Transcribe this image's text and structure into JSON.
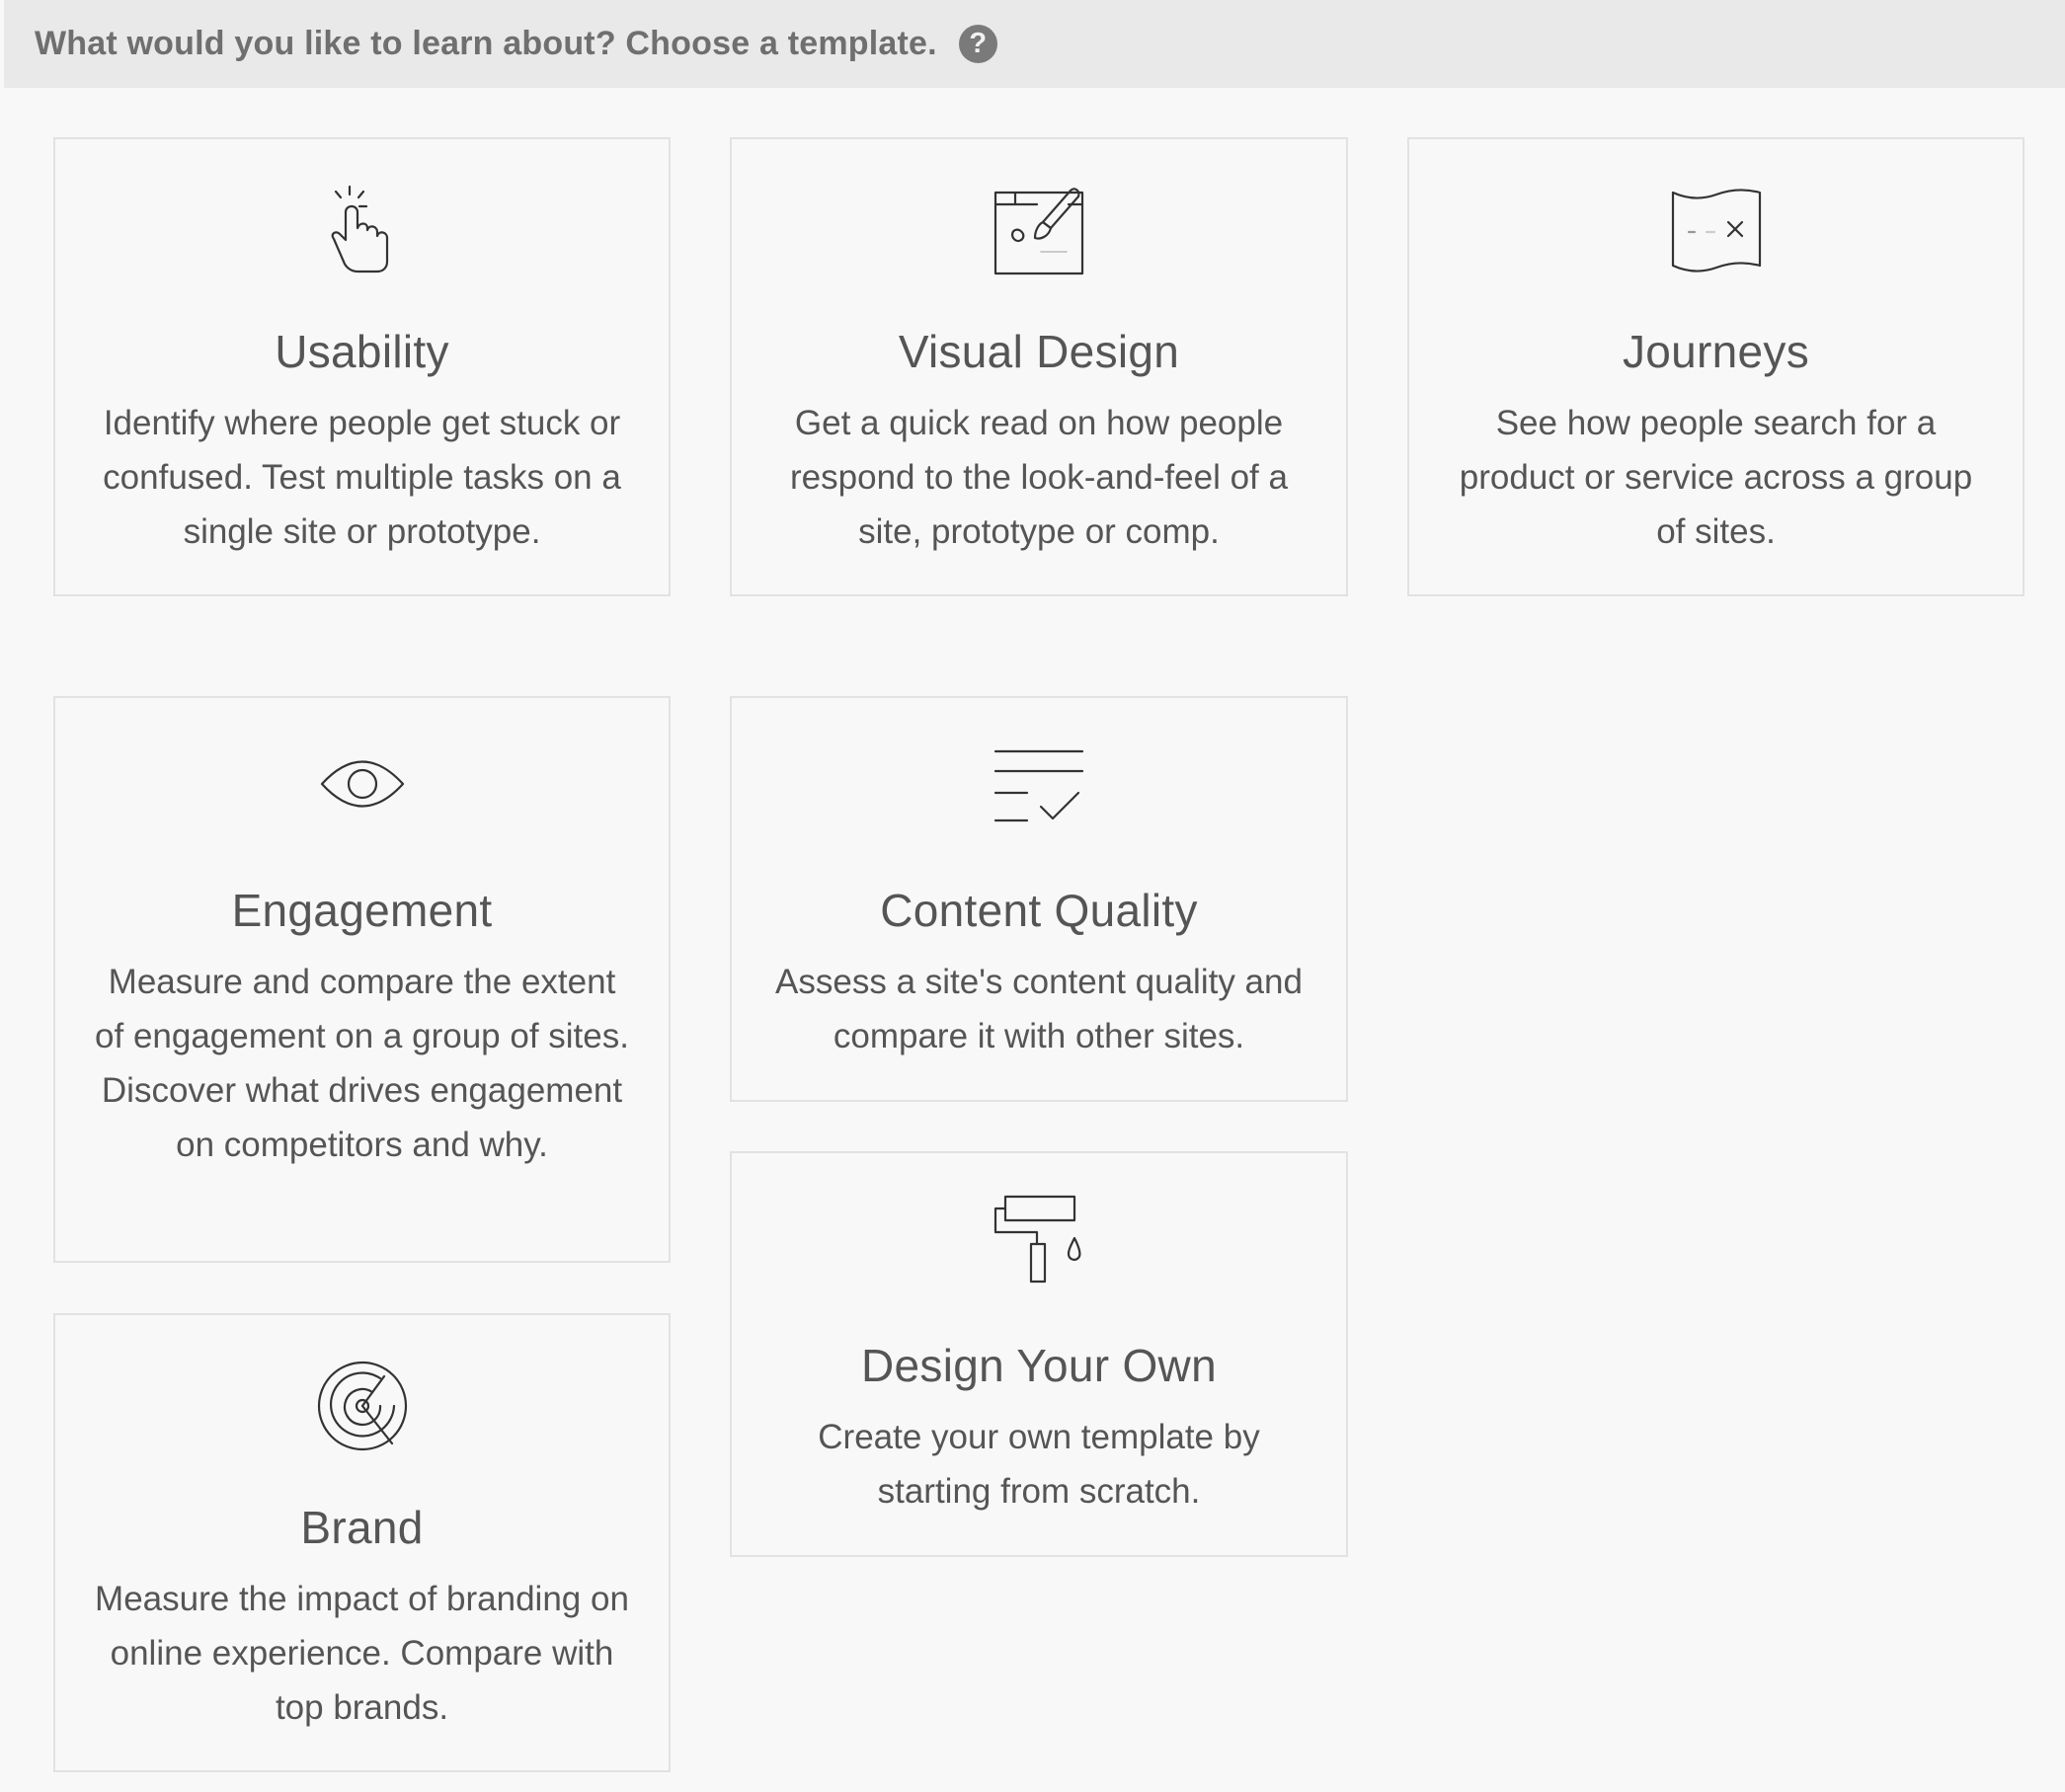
{
  "header": {
    "title": "What would you like to learn about? Choose a template.",
    "help_icon": "?"
  },
  "cards": [
    {
      "icon": "pointer-hand-icon",
      "title": "Usability",
      "description": "Identify where people get stuck or confused. Test multiple tasks on a single site or prototype."
    },
    {
      "icon": "design-board-icon",
      "title": "Visual Design",
      "description": "Get a quick read on how people respond to the look-and-feel of a site, prototype or comp."
    },
    {
      "icon": "map-icon",
      "title": "Journeys",
      "description": "See how people search for a product or service across a group of sites."
    },
    {
      "icon": "eye-icon",
      "title": "Engagement",
      "description": "Measure and compare the extent of engagement on a group of sites. Discover what drives engagement on competitors and why."
    },
    {
      "icon": "checklist-icon",
      "title": "Content Quality",
      "description": "Assess a site's content quality and compare it with other sites."
    },
    {
      "icon": "paint-roller-icon",
      "title": "Design Your Own",
      "description": "Create your own template by starting from scratch."
    },
    {
      "icon": "target-icon",
      "title": "Brand",
      "description": "Measure the impact of branding on online experience. Compare with top brands."
    }
  ]
}
